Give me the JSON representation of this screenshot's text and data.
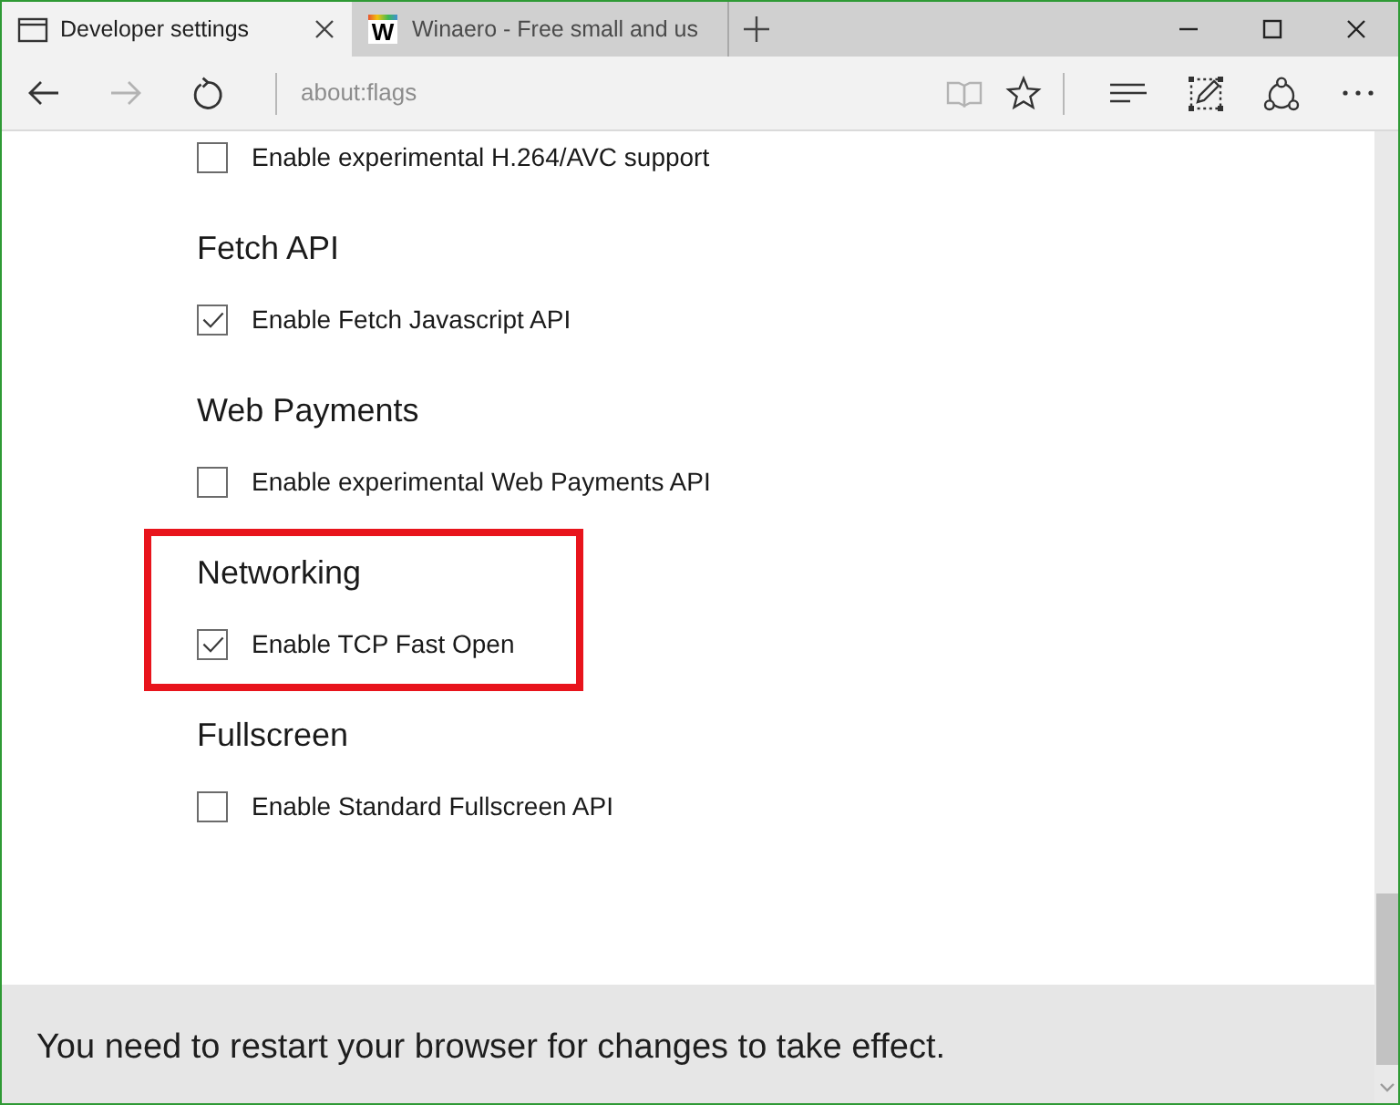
{
  "tabs": [
    {
      "title": "Developer settings",
      "selected": true,
      "favicon": {
        "kind": "page"
      }
    },
    {
      "title": "Winaero - Free small and us",
      "selected": false,
      "favicon": {
        "kind": "letter",
        "text": "W"
      }
    }
  ],
  "window_controls": [
    {
      "kind": "minimize"
    },
    {
      "kind": "maximize"
    },
    {
      "kind": "close"
    }
  ],
  "toolbar": {
    "navigation": [
      {
        "kind": "back",
        "disabled": false
      },
      {
        "kind": "forward",
        "disabled": true
      },
      {
        "kind": "refresh",
        "disabled": false
      }
    ],
    "address": {
      "value": "about:flags"
    },
    "page_actions": [
      {
        "kind": "reading-view",
        "disabled": true
      },
      {
        "kind": "favorite",
        "disabled": false
      }
    ],
    "app_actions": [
      {
        "kind": "hub",
        "disabled": false
      },
      {
        "kind": "note",
        "disabled": false
      },
      {
        "kind": "share",
        "disabled": false
      },
      {
        "kind": "more",
        "disabled": false
      }
    ]
  },
  "sections": [
    {
      "highlighted": false,
      "options": [
        {
          "label": "Enable experimental H.264/AVC support",
          "checked": false
        }
      ]
    },
    {
      "heading": "Fetch API",
      "highlighted": false,
      "options": [
        {
          "label": "Enable Fetch Javascript API",
          "checked": true
        }
      ]
    },
    {
      "heading": "Web Payments",
      "highlighted": false,
      "options": [
        {
          "label": "Enable experimental Web Payments API",
          "checked": false
        }
      ]
    },
    {
      "heading": "Networking",
      "highlighted": true,
      "options": [
        {
          "label": "Enable TCP Fast Open",
          "checked": true
        }
      ]
    },
    {
      "heading": "Fullscreen",
      "highlighted": false,
      "options": [
        {
          "label": "Enable Standard Fullscreen API",
          "checked": false
        }
      ]
    }
  ],
  "notice": {
    "text": "You need to restart your browser for changes to take effect."
  }
}
